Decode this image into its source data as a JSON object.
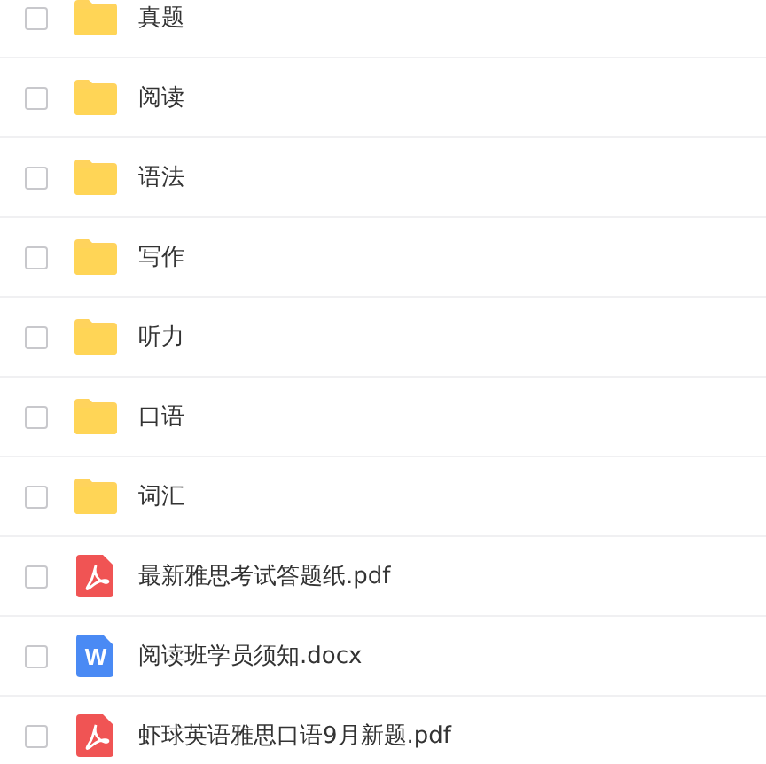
{
  "files": [
    {
      "kind": "folder",
      "name": "真题",
      "checked": false
    },
    {
      "kind": "folder",
      "name": "阅读",
      "checked": false
    },
    {
      "kind": "folder",
      "name": "语法",
      "checked": false
    },
    {
      "kind": "folder",
      "name": "写作",
      "checked": false
    },
    {
      "kind": "folder",
      "name": "听力",
      "checked": false
    },
    {
      "kind": "folder",
      "name": "口语",
      "checked": false
    },
    {
      "kind": "folder",
      "name": "词汇",
      "checked": false
    },
    {
      "kind": "pdf",
      "name": "最新雅思考试答题纸.pdf",
      "checked": false
    },
    {
      "kind": "word",
      "name": "阅读班学员须知.docx",
      "checked": false,
      "icon_letter": "W"
    },
    {
      "kind": "pdf",
      "name": "虾球英语雅思口语9月新题.pdf",
      "checked": false
    }
  ]
}
